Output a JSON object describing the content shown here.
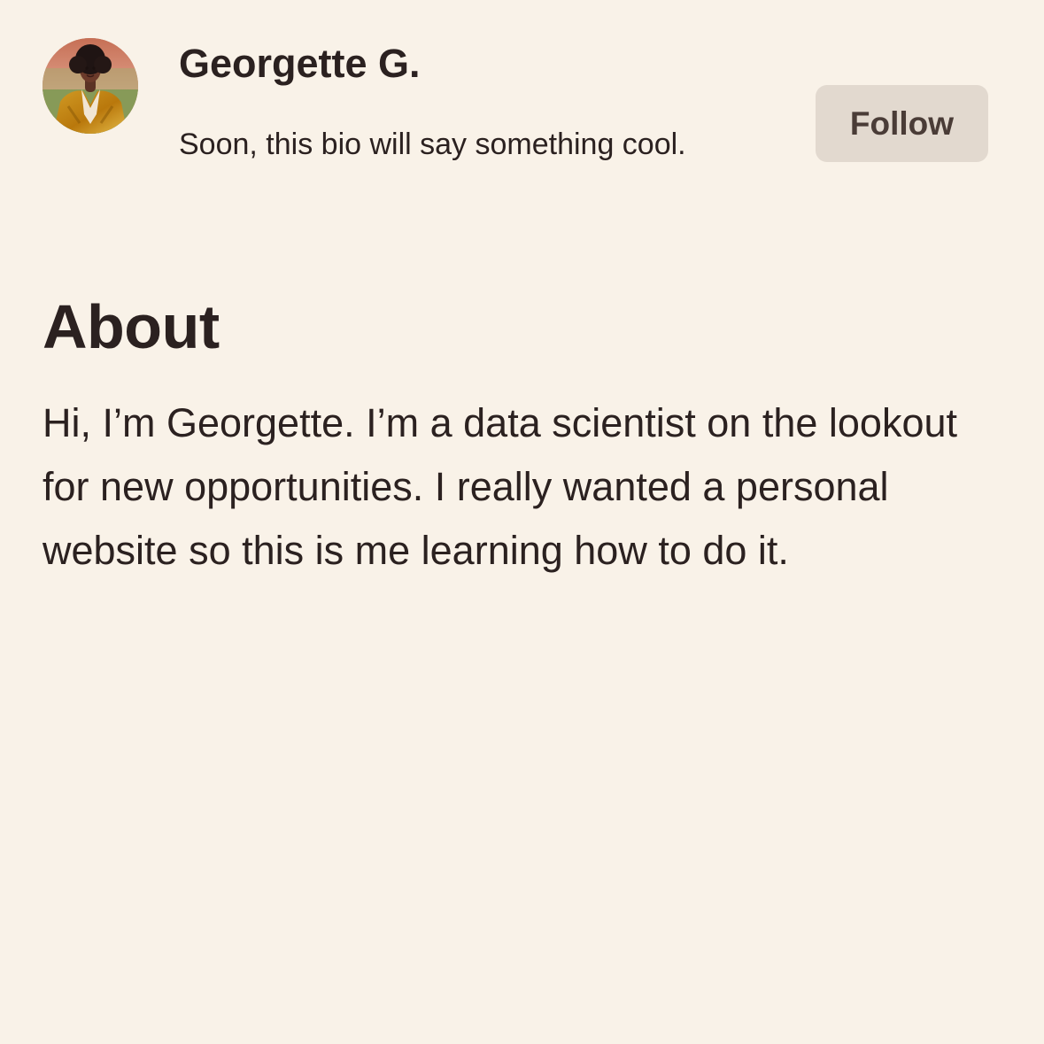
{
  "profile": {
    "avatar_icon": "profile-photo",
    "name": "Georgette G.",
    "bio": "Soon, this bio will say something cool.",
    "follow_label": "Follow"
  },
  "about": {
    "heading": "About",
    "text": "Hi, I’m Georgette. I’m a data scientist on the lookout for new opportunities. I really wanted a personal website so this is me learning how to do it."
  },
  "colors": {
    "background": "#f9f2e8",
    "text": "#2b2120",
    "button_background": "#e2d9cf",
    "button_text": "#4a3c37"
  }
}
